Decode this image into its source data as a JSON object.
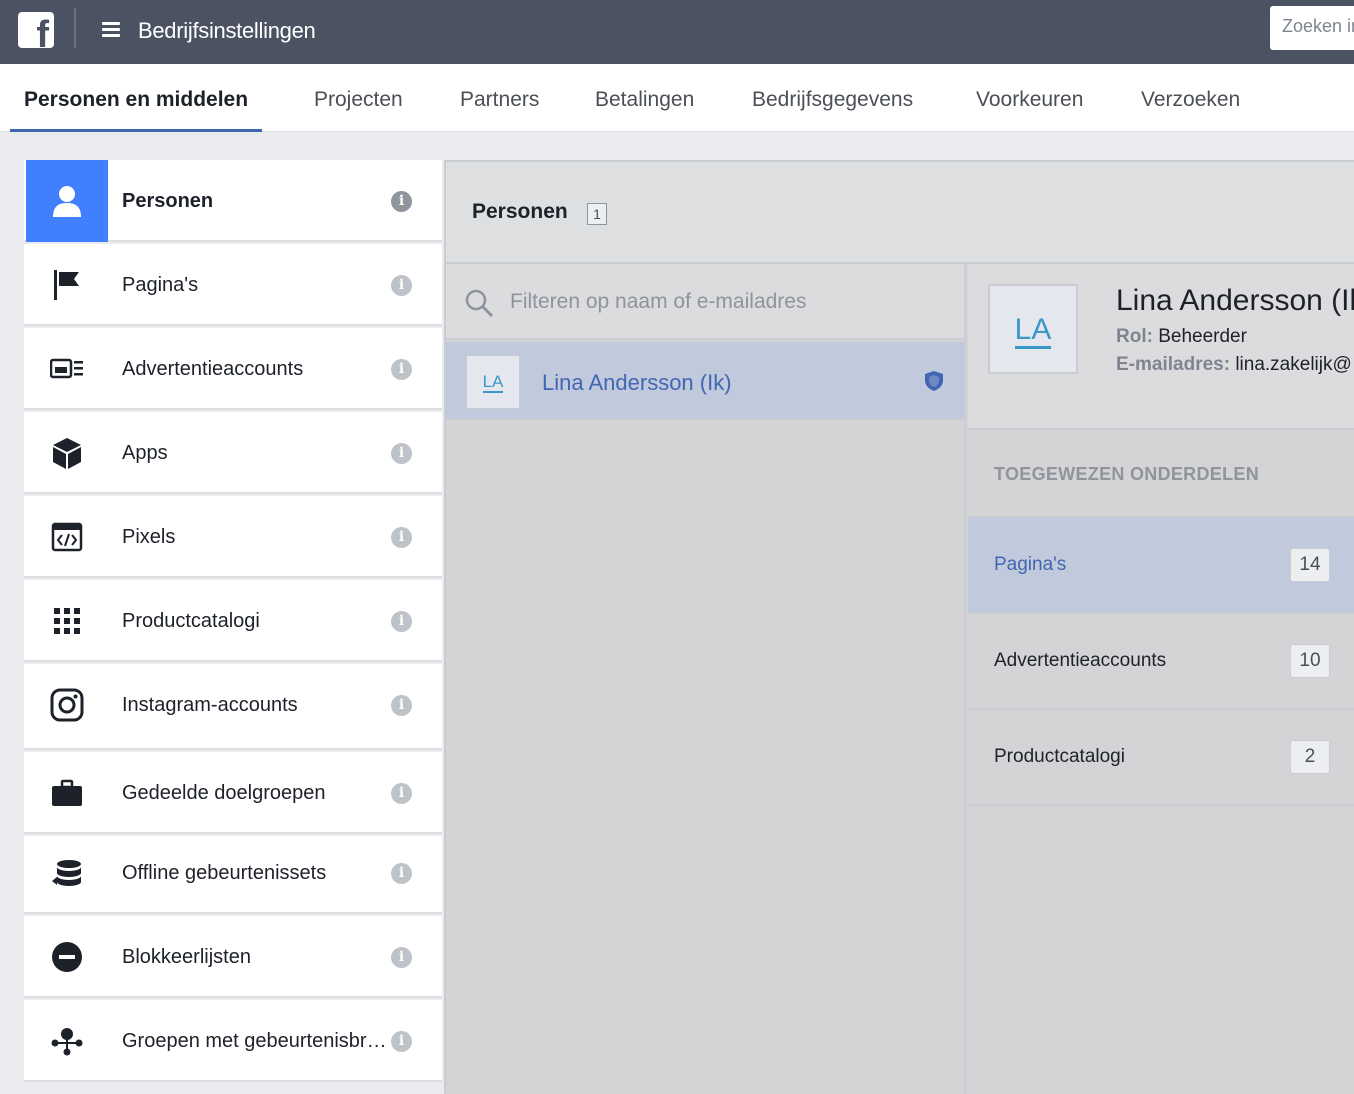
{
  "topbar": {
    "logo_letter": "f",
    "title": "Bedrijfsinstellingen",
    "search_placeholder": "Zoeken in bedrijf"
  },
  "tabs": [
    {
      "label": "Personen en middelen",
      "active": true
    },
    {
      "label": "Projecten"
    },
    {
      "label": "Partners"
    },
    {
      "label": "Betalingen"
    },
    {
      "label": "Bedrijfsgegevens"
    },
    {
      "label": "Voorkeuren"
    },
    {
      "label": "Verzoeken"
    }
  ],
  "sidebar": {
    "items": [
      {
        "label": "Personen",
        "icon": "person-icon",
        "active": true
      },
      {
        "label": "Pagina's",
        "icon": "flag-icon"
      },
      {
        "label": "Advertentieaccounts",
        "icon": "ad-account-icon"
      },
      {
        "label": "Apps",
        "icon": "cube-icon"
      },
      {
        "label": "Pixels",
        "icon": "code-icon"
      },
      {
        "label": "Productcatalogi",
        "icon": "grid-icon"
      },
      {
        "label": "Instagram-accounts",
        "icon": "instagram-icon"
      },
      {
        "label": "Gedeelde doelgroepen",
        "icon": "briefcase-icon"
      },
      {
        "label": "Offline gebeurtenissets",
        "icon": "database-icon"
      },
      {
        "label": "Blokkeerlijsten",
        "icon": "block-icon"
      },
      {
        "label": "Groepen met gebeurtenisbronnen",
        "icon": "network-icon"
      }
    ],
    "info_glyph": "i"
  },
  "panel": {
    "title": "Personen",
    "count": "1",
    "filter_placeholder": "Filteren op naam of e-mailadres"
  },
  "people": [
    {
      "initials": "LA",
      "name": "Lina Andersson (Ik)"
    }
  ],
  "detail": {
    "initials": "LA",
    "name": "Lina Andersson (Ik)",
    "role_label": "Rol:",
    "role_value": "Beheerder",
    "email_label": "E-mailadres:",
    "email_value": "lina.zakelijk@",
    "section_title": "TOEGEWEZEN ONDERDELEN",
    "assets": [
      {
        "name": "Pagina's",
        "count": "14",
        "selected": true
      },
      {
        "name": "Advertentieaccounts",
        "count": "10"
      },
      {
        "name": "Productcatalogi",
        "count": "2"
      }
    ]
  },
  "colors": {
    "topbar": "#4b5261",
    "accent": "#4267b2",
    "active_icon_bg": "#4080ff",
    "selected_row": "#c1c9dc"
  }
}
